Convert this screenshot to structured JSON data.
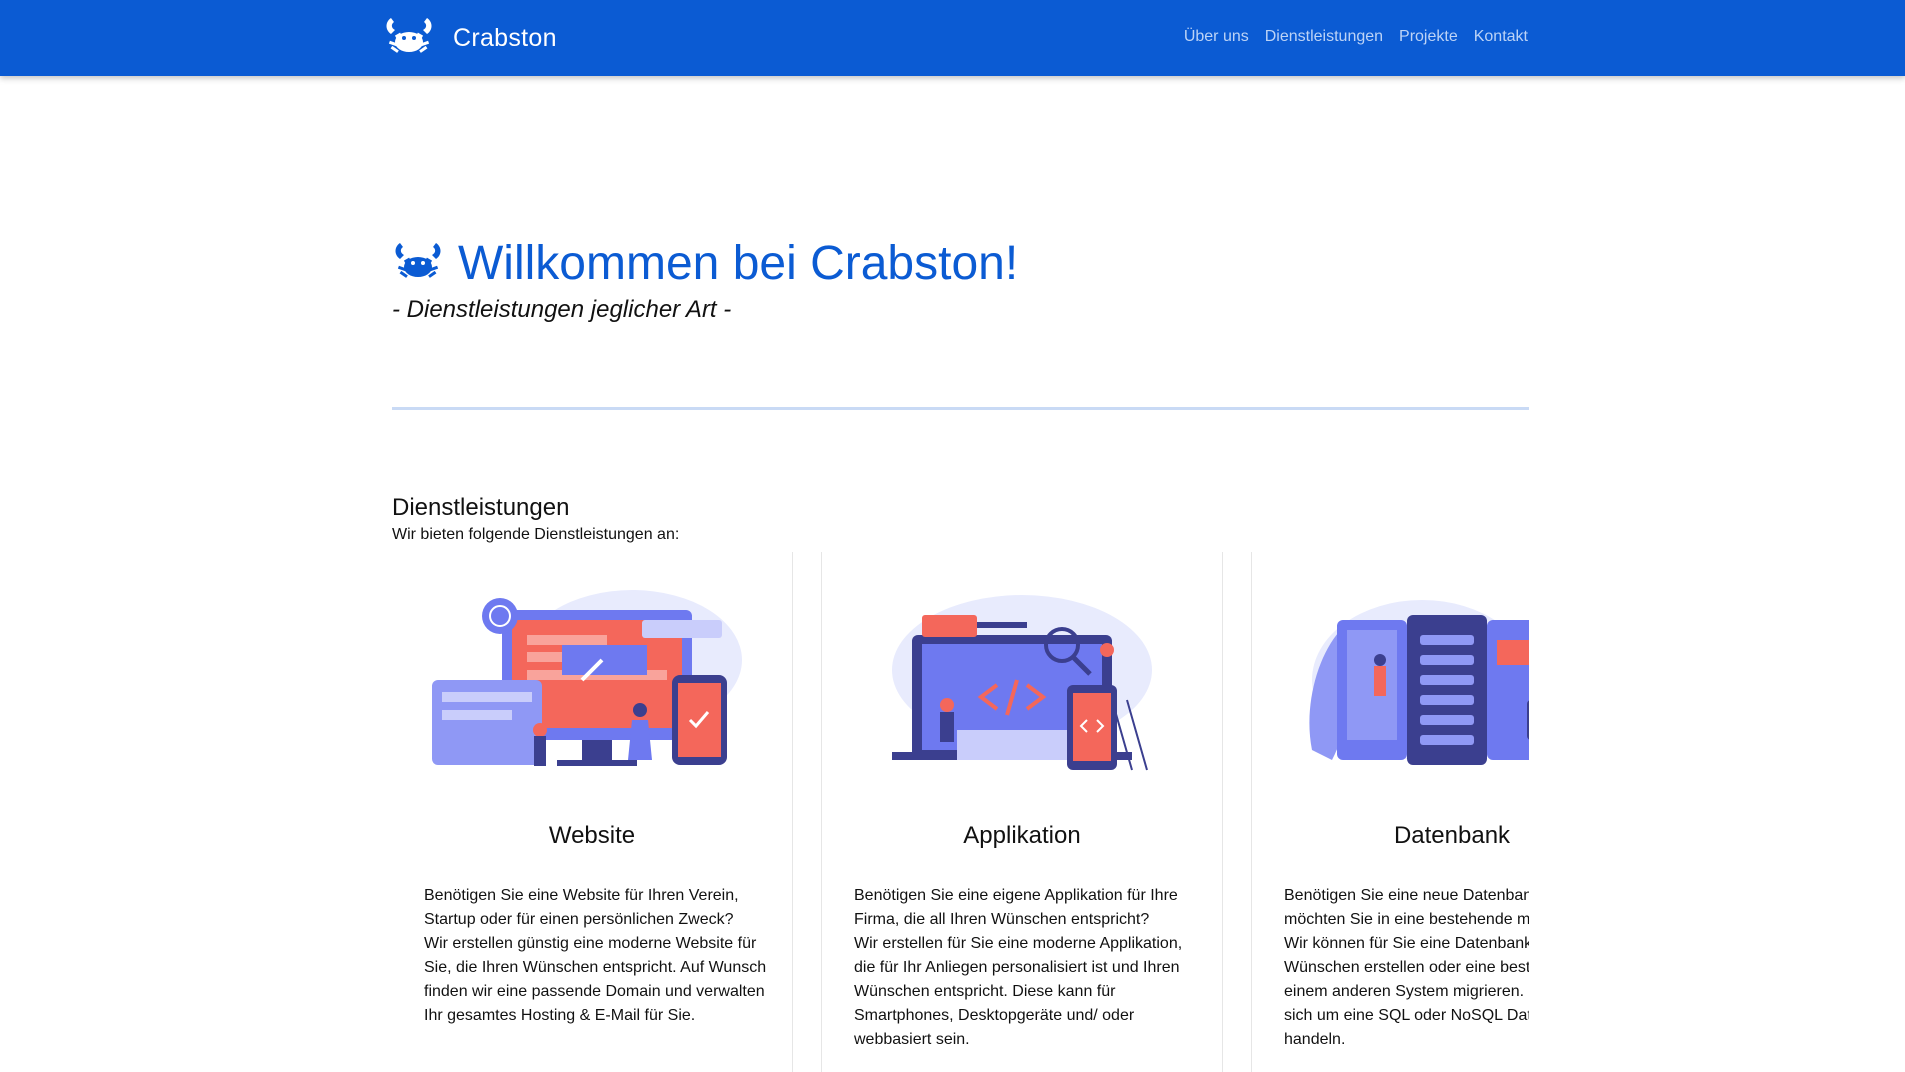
{
  "header": {
    "brand": "Crabston",
    "logo_icon": "crab-icon",
    "nav": [
      "Über uns",
      "Dienstleistungen",
      "Projekte",
      "Kontakt"
    ]
  },
  "hero": {
    "title": "Willkommen bei Crabston!",
    "subtitle": "- Dienstleistungen jeglicher Art -"
  },
  "services": {
    "title": "Dienstleistungen",
    "description": "Wir bieten folgende Dienstleistungen an:",
    "cards": [
      {
        "title": "Website",
        "line1": "Benötigen Sie eine Website für Ihren Verein, Startup oder für einen persönlichen Zweck?",
        "line2": "Wir erstellen günstig eine moderne Website für Sie, die Ihren Wünschen entspricht. Auf Wunsch finden wir eine passende Domain und verwalten Ihr gesamtes Hosting & E-Mail für Sie."
      },
      {
        "title": "Applikation",
        "line1": "Benötigen Sie eine eigene Applikation für Ihre Firma, die all Ihren Wünschen entspricht?",
        "line2": "Wir erstellen für Sie eine moderne Applikation, die für Ihr Anliegen personalisiert ist und Ihren Wünschen entspricht. Diese kann für Smartphones, Desktopgeräte und/ oder webbasiert sein."
      },
      {
        "title": "Datenbank",
        "line1": "Benötigen Sie eine neue Datenbank oder möchten Sie in eine bestehende migrieren?",
        "line2": "Wir können für Sie eine Datenbank nach Ihren Wünschen erstellen oder eine bestehende aus einem anderen System migrieren. Egal ob es sich um eine SQL oder NoSQL Datenbank handeln."
      }
    ]
  },
  "colors": {
    "primary": "#0b5bd3",
    "nav_text": "#bcd3f6",
    "divider": "#c9daf5",
    "illustration_blue": "#6e79f0",
    "illustration_red": "#f4675b"
  }
}
